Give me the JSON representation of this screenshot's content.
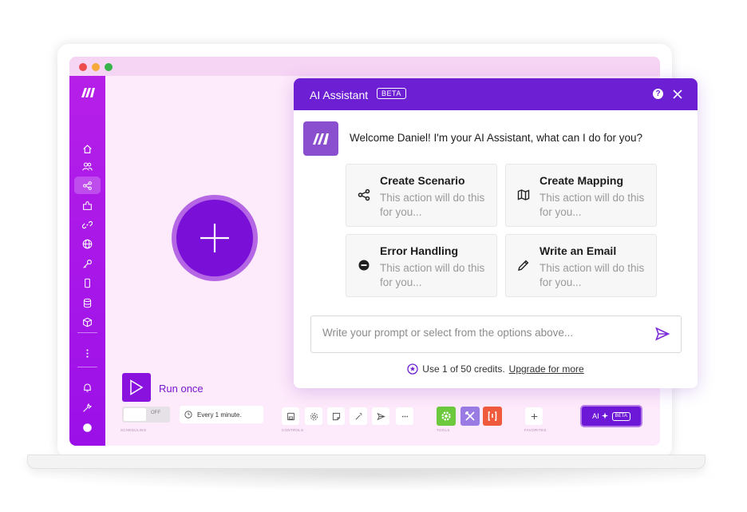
{
  "sidebar": {
    "logo": "make-logo",
    "items": [
      "home-icon",
      "users-icon",
      "share-icon",
      "puzzle-icon",
      "link-icon",
      "globe-icon",
      "key-icon",
      "phone-icon",
      "database-icon",
      "cube-icon",
      "more-icon",
      "bell-icon",
      "wrench-icon",
      "avatar"
    ]
  },
  "canvas": {
    "run_label": "Run once",
    "toggle_off": "OFF",
    "schedule": "Every 1 minute.",
    "labels": {
      "scheduling": "SCHEDULING",
      "controls": "CONTROLS",
      "tools": "TOOLS",
      "favorites": "FAVORITES"
    },
    "ai_label": "AI",
    "ai_beta": "BETA"
  },
  "assistant": {
    "title": "AI Assistant",
    "beta": "BETA",
    "help": "?",
    "welcome": "Welcome Daniel! I'm your AI Assistant, what can I do for you?",
    "cards": [
      {
        "title": "Create Scenario",
        "desc": "This action will do this for you...",
        "icon": "share-icon"
      },
      {
        "title": "Create Mapping",
        "desc": "This action will do this for you...",
        "icon": "map-icon"
      },
      {
        "title": "Error Handling",
        "desc": "This action will do this for you...",
        "icon": "minus-circle-icon"
      },
      {
        "title": "Write an Email",
        "desc": "This action will do this for you...",
        "icon": "pencil-icon"
      }
    ],
    "prompt_placeholder": "Write your prompt or select from the options above...",
    "credits_text": "Use 1 of 50 credits.",
    "upgrade_link": "Upgrade for more"
  },
  "colors": {
    "brand_purple": "#6c1fd3",
    "sidebar": "#a516e8",
    "canvas_bg": "#fdeafa"
  }
}
